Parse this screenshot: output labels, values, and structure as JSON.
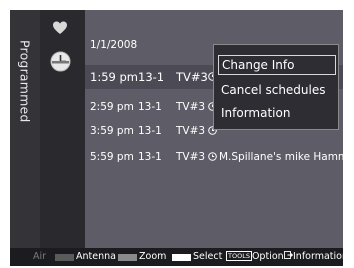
{
  "sidebar": {
    "title": "Programmed"
  },
  "icons": {
    "top": "heart-icon",
    "selected": "clock-icon"
  },
  "list": {
    "date": "1/1/2008",
    "rows": [
      {
        "time": "1:59 pm",
        "channel": "13-1",
        "source": "TV#3",
        "program": ""
      },
      {
        "time": "2:59 pm",
        "channel": "13-1",
        "source": "TV#3",
        "program": ""
      },
      {
        "time": "3:59 pm",
        "channel": "13-1",
        "source": "TV#3",
        "program": ""
      },
      {
        "time": "5:59 pm",
        "channel": "13-1",
        "source": "TV#3",
        "program": "M.Spillane's mike Hammer"
      }
    ]
  },
  "menu": {
    "items": [
      "Change Info",
      "Cancel schedules",
      "Information"
    ],
    "active_index": 0
  },
  "footer": {
    "air": "Air",
    "antenna": "Antenna",
    "zoom": "Zoom",
    "select": "Select",
    "tools_badge": "TOOLS",
    "option": "Option",
    "information": "Information"
  },
  "colors": {
    "background": "#343339",
    "panel": "#5e5c67",
    "selected_row": "#4c4a54",
    "menu_bg": "#2e2d33",
    "footer_bg": "#1c1c20",
    "swatch_antenna": "#5a5a5a",
    "swatch_zoom": "#8a8a8a",
    "swatch_select": "#ffffff"
  }
}
